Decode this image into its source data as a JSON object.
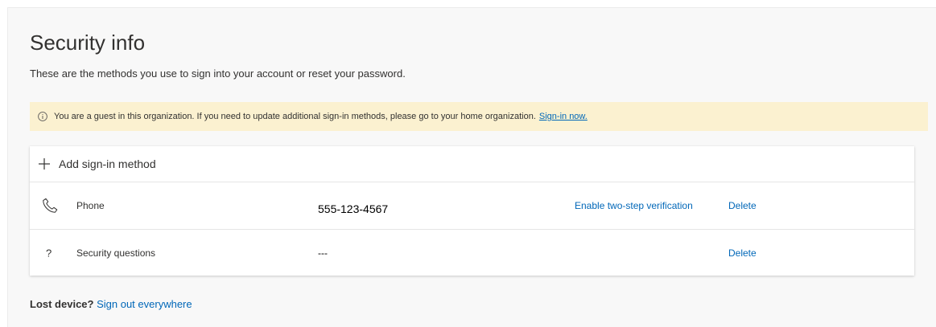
{
  "header": {
    "title": "Security info",
    "subtitle": "These are the methods you use to sign into your account or reset your password."
  },
  "banner": {
    "icon": "info-icon",
    "message": "You are a guest in this organization. If you need to update additional sign-in methods, please go to your home organization.",
    "link_label": "Sign-in now.",
    "background_color": "#fbf1d0"
  },
  "methods": {
    "add_label": "Add sign-in method",
    "add_icon": "plus-icon",
    "rows": [
      {
        "icon": "phone-icon",
        "name": "Phone",
        "value": "555-123-4567",
        "enable_label": "Enable two-step verification",
        "delete_label": "Delete"
      },
      {
        "icon": "question-mark-icon",
        "icon_glyph": "?",
        "name": "Security questions",
        "value": "---",
        "delete_label": "Delete"
      }
    ]
  },
  "footer": {
    "label": "Lost device?",
    "link_label": "Sign out everywhere"
  },
  "colors": {
    "link": "#0067b8",
    "text": "#323130",
    "page_background": "#f8f8f8"
  }
}
